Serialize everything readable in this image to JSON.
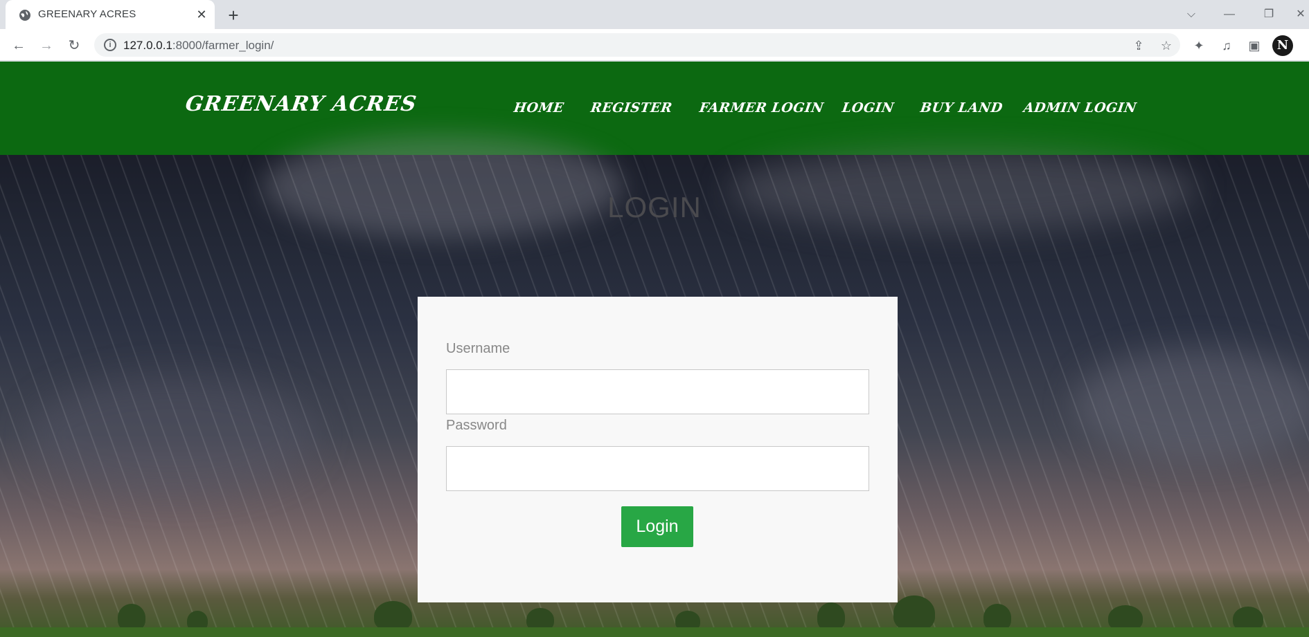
{
  "browser": {
    "tab_title": "GREENARY ACRES",
    "tab_close": "✕",
    "new_tab": "+",
    "url_host": "127.0.0.1",
    "url_rest": ":8000/farmer_login/",
    "back": "←",
    "forward": "→",
    "reload": "↻",
    "window_controls": {
      "dropdown": "⌵",
      "minimize": "—",
      "restore": "❐",
      "close": "✕"
    },
    "toolbar_icons": {
      "share": "⇪",
      "bookmark": "☆",
      "extensions": "✦",
      "media": "♫",
      "sidepanel": "▣"
    },
    "profile_initial": "N"
  },
  "site": {
    "brand": "GREENARY ACRES",
    "nav_color": "#0c6911",
    "menu": [
      "HOME",
      "REGISTER",
      "FARMER LOGIN",
      "LOGIN",
      "BUY LAND",
      "ADMIN LOGIN"
    ]
  },
  "login": {
    "title": "LOGIN",
    "username_label": "Username",
    "username_value": "",
    "password_label": "Password",
    "password_value": "",
    "submit_label": "Login",
    "button_color": "#28a745"
  }
}
